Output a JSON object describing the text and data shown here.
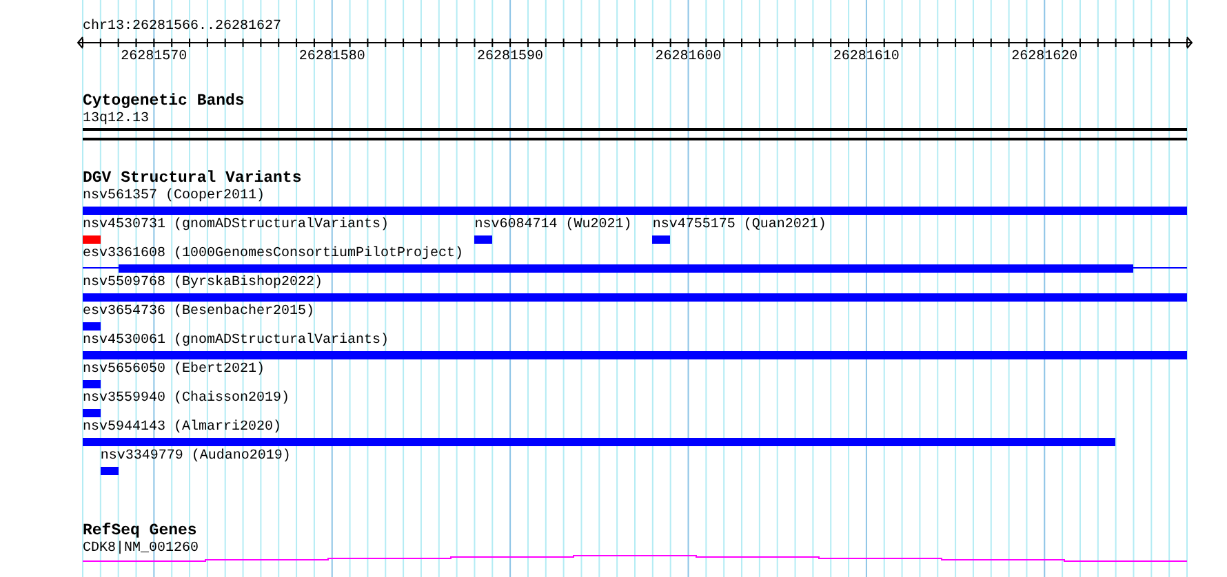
{
  "ruler": {
    "title": "chr13:26281566..26281627",
    "ticks": [
      "26281570",
      "26281580",
      "26281590",
      "26281600",
      "26281610",
      "26281620"
    ]
  },
  "tracks": [
    {
      "kind": "bands",
      "title": "Cytogenetic Bands",
      "label": "13q12.13"
    },
    {
      "kind": "variants",
      "title": "DGV Structural Variants",
      "rows": [
        {
          "features": [
            {
              "label": "nsv561357 (Cooper2011)",
              "color": "#0000ff"
            }
          ]
        },
        {
          "features": [
            {
              "label": "nsv4530731 (gnomADStructuralVariants)",
              "color": "#ff0000"
            },
            {
              "label": "nsv6084714 (Wu2021)",
              "color": "#0000ff"
            },
            {
              "label": "nsv4755175 (Quan2021)",
              "color": "#0000ff"
            }
          ]
        },
        {
          "features": [
            {
              "label": "esv3361608 (1000GenomesConsortiumPilotProject)",
              "color": "#0000ff"
            }
          ]
        },
        {
          "features": [
            {
              "label": "nsv5509768 (ByrskaBishop2022)",
              "color": "#0000ff"
            }
          ]
        },
        {
          "features": [
            {
              "label": "esv3654736 (Besenbacher2015)",
              "color": "#0000ff"
            }
          ]
        },
        {
          "features": [
            {
              "label": "nsv4530061 (gnomADStructuralVariants)",
              "color": "#0000ff"
            }
          ]
        },
        {
          "features": [
            {
              "label": "nsv5656050 (Ebert2021)",
              "color": "#0000ff"
            }
          ]
        },
        {
          "features": [
            {
              "label": "nsv3559940 (Chaisson2019)",
              "color": "#0000ff"
            }
          ]
        },
        {
          "features": [
            {
              "label": "nsv5944143 (Almarri2020)",
              "color": "#0000ff"
            }
          ]
        },
        {
          "features": [
            {
              "label": "nsv3349779 (Audano2019)",
              "color": "#0000ff"
            }
          ]
        }
      ]
    },
    {
      "kind": "genes",
      "title": "RefSeq Genes",
      "label": "CDK8|NM_001260"
    }
  ]
}
